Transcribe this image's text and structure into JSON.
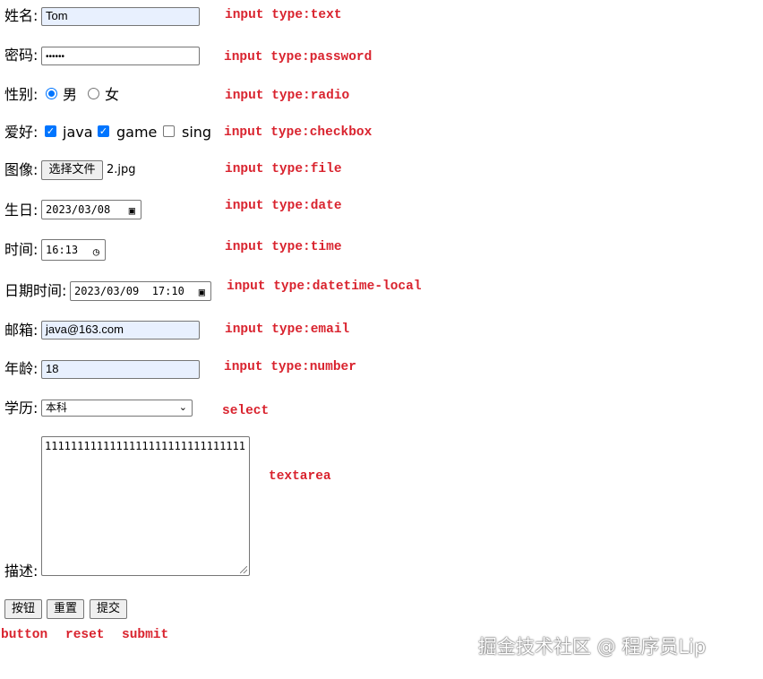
{
  "form": {
    "name": {
      "label": "姓名:",
      "value": "Tom",
      "note": "input type:text"
    },
    "password": {
      "label": "密码:",
      "value": "••••••",
      "note": "input type:password"
    },
    "gender": {
      "label": "性别:",
      "options": [
        "男",
        "女"
      ],
      "selected": "男",
      "note": "input type:radio"
    },
    "hobby": {
      "label": "爱好:",
      "options": [
        "java",
        "game",
        "sing"
      ],
      "checked": [
        "java",
        "game"
      ],
      "note": "input type:checkbox"
    },
    "image": {
      "label": "图像:",
      "button": "选择文件",
      "filename": "2.jpg",
      "note": "input type:file"
    },
    "birthday": {
      "label": "生日:",
      "value": "2023/03/08",
      "note": "input type:date"
    },
    "time": {
      "label": "时间:",
      "value": "16:13",
      "note": "input type:time"
    },
    "datetime": {
      "label": "日期时间:",
      "value": "2023/03/09  17:10",
      "note": "input type:datetime-local"
    },
    "email": {
      "label": "邮箱:",
      "value": "java@163.com",
      "note": "input type:email"
    },
    "age": {
      "label": "年龄:",
      "value": "18",
      "note": "input type:number"
    },
    "education": {
      "label": "学历:",
      "value": "本科",
      "note": "select"
    },
    "description": {
      "label": "描述:",
      "value": "1111111111111111111111111111111",
      "note": "textarea"
    }
  },
  "buttons": {
    "button": {
      "label": "按钮",
      "note": "button"
    },
    "reset": {
      "label": "重置",
      "note": "reset"
    },
    "submit": {
      "label": "提交",
      "note": "submit"
    }
  },
  "icons": {
    "calendar": "calendar-icon",
    "clock": "clock-icon",
    "dropdown": "chevron-down-icon",
    "check": "checkmark-icon"
  },
  "colors": {
    "annotation": "#d9232e",
    "accent": "#0075ff",
    "autofill": "#e8f0fe"
  },
  "watermark": "掘金技术社区 @ 程序员Lip"
}
